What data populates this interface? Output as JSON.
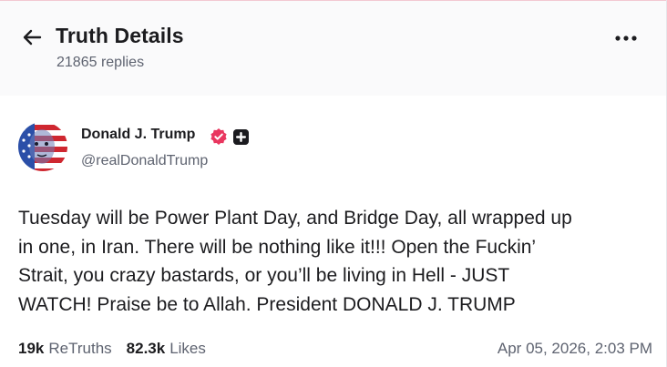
{
  "header": {
    "title": "Truth Details",
    "replies": "21865 replies",
    "back_icon": "arrow-left-icon",
    "more_icon": "more-horizontal-icon"
  },
  "post": {
    "author": {
      "name": "Donald J. Trump",
      "handle": "@realDonaldTrump",
      "verified_badge_color": "#e9365f",
      "plus_badge_color": "#1b1b1f"
    },
    "body": "Tuesday will be Power Plant Day, and Bridge Day, all wrapped up\nin one, in Iran. There will be nothing like it!!! Open the Fuckin’\nStrait, you crazy bastards, or you’ll be living in Hell - JUST\nWATCH! Praise be to Allah. President DONALD J. TRUMP",
    "stats": {
      "retruths_count": "19k",
      "retruths_label": "ReTruths",
      "likes_count": "82.3k",
      "likes_label": "Likes"
    },
    "timestamp": "Apr 05, 2026, 2:03 PM"
  }
}
